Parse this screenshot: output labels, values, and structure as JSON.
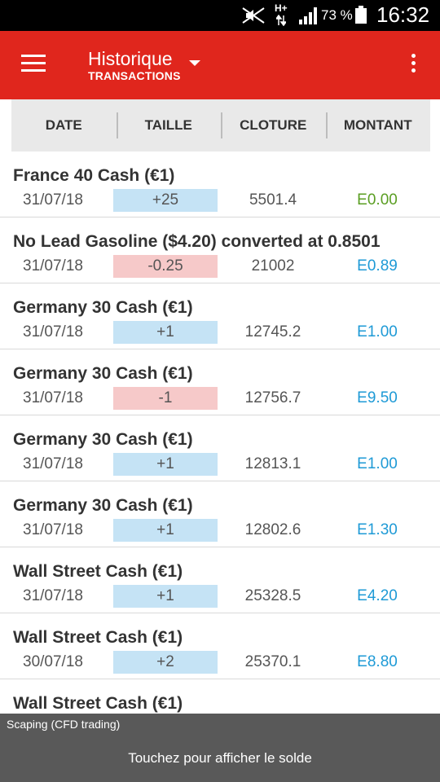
{
  "status_bar": {
    "network_type": "H+",
    "battery_percent": "73 %",
    "time": "16:32",
    "icons": [
      "mute-icon",
      "data-arrows-icon",
      "signal-icon",
      "battery-icon"
    ]
  },
  "app_bar": {
    "title": "Historique",
    "subtitle": "TRANSACTIONS",
    "icons": [
      "hamburger-menu-icon",
      "dropdown-caret-icon",
      "more-vert-icon"
    ],
    "color": "#e0261d"
  },
  "columns": [
    "DATE",
    "TAILLE",
    "CLOTURE",
    "MONTANT"
  ],
  "colors": {
    "positive_size_bg": "#c5e3f5",
    "negative_size_bg": "#f6c9c9",
    "amount_blue": "#1e9ad6",
    "amount_green": "#5a9e22"
  },
  "transactions": [
    {
      "name": "France 40 Cash (€1)",
      "date": "31/07/18",
      "size": "+25",
      "size_sign": "pos",
      "close": "5501.4",
      "amount": "E0.00",
      "amount_color": "green"
    },
    {
      "name": "No Lead Gasoline ($4.20) converted at 0.8501",
      "date": "31/07/18",
      "size": "-0.25",
      "size_sign": "neg",
      "close": "21002",
      "amount": "E0.89",
      "amount_color": "blue"
    },
    {
      "name": "Germany 30 Cash (€1)",
      "date": "31/07/18",
      "size": "+1",
      "size_sign": "pos",
      "close": "12745.2",
      "amount": "E1.00",
      "amount_color": "blue"
    },
    {
      "name": "Germany 30 Cash (€1)",
      "date": "31/07/18",
      "size": "-1",
      "size_sign": "neg",
      "close": "12756.7",
      "amount": "E9.50",
      "amount_color": "blue"
    },
    {
      "name": "Germany 30 Cash (€1)",
      "date": "31/07/18",
      "size": "+1",
      "size_sign": "pos",
      "close": "12813.1",
      "amount": "E1.00",
      "amount_color": "blue"
    },
    {
      "name": "Germany 30 Cash (€1)",
      "date": "31/07/18",
      "size": "+1",
      "size_sign": "pos",
      "close": "12802.6",
      "amount": "E1.30",
      "amount_color": "blue"
    },
    {
      "name": "Wall Street Cash (€1)",
      "date": "31/07/18",
      "size": "+1",
      "size_sign": "pos",
      "close": "25328.5",
      "amount": "E4.20",
      "amount_color": "blue"
    },
    {
      "name": "Wall Street Cash (€1)",
      "date": "30/07/18",
      "size": "+2",
      "size_sign": "pos",
      "close": "25370.1",
      "amount": "E8.80",
      "amount_color": "blue"
    },
    {
      "name": "Wall Street Cash (€1)",
      "date": "",
      "size": "",
      "size_sign": "none",
      "close": "",
      "amount": "",
      "amount_color": "blue"
    }
  ],
  "footer": {
    "account_label": "Scaping (CFD trading)",
    "cta": "Touchez pour afficher le solde"
  }
}
